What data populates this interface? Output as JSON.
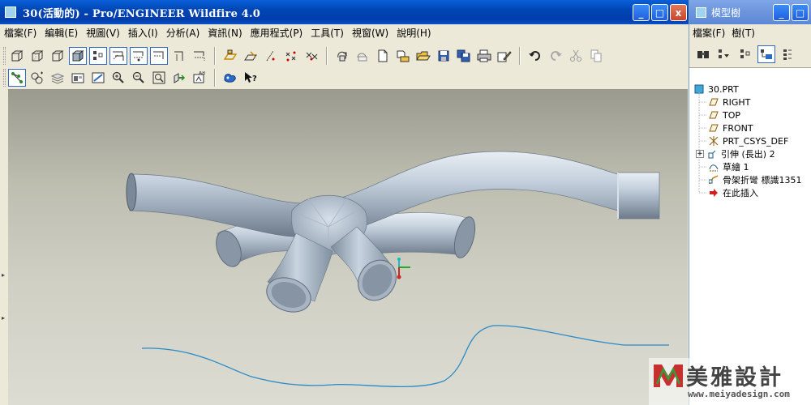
{
  "main_window": {
    "title": "30(活動的) - Pro/ENGINEER Wildfire 4.0",
    "menu": [
      "檔案(F)",
      "編輯(E)",
      "視圖(V)",
      "插入(I)",
      "分析(A)",
      "資訊(N)",
      "應用程式(P)",
      "工具(T)",
      "視窗(W)",
      "說明(H)"
    ],
    "window_controls": [
      "_",
      "□",
      "x"
    ]
  },
  "toolbar_icons_row1": [
    "view-wireframe-icon",
    "view-hidden-line-icon",
    "view-no-hidden-icon",
    "view-shading-icon",
    "datum-display-icon",
    "datum-axis-icon",
    "datum-point-icon",
    "datum-csys-icon",
    "datum-curve-icon",
    "datum-plane-tool-icon",
    "sketch-plane-icon",
    "datum-axis-tool-icon",
    "datum-point-tool-icon",
    "datum-csys-tool-icon",
    "regenerate-icon",
    "regen-manager-icon",
    "new-file-icon",
    "open-file-icon",
    "folder-browser-icon",
    "save-icon",
    "save-copy-icon",
    "print-icon",
    "sketch-tool-icon",
    "undo-icon",
    "redo-icon",
    "cut-icon",
    "copy-icon"
  ],
  "toolbar_icons_row2": [
    "select-node-icon",
    "named-views-icon",
    "layers-icon",
    "view-manager-icon",
    "repaint-icon",
    "zoom-in-icon",
    "zoom-out-icon",
    "refit-icon",
    "reorient-icon",
    "saved-views-icon",
    "model-tree-toggle-icon",
    "context-help-icon"
  ],
  "model_tree": {
    "title": "模型樹",
    "menu": [
      "檔案(F)",
      "樹(T)"
    ],
    "nodes": [
      {
        "label": "30.PRT",
        "icon": "part-icon"
      },
      {
        "label": "RIGHT",
        "icon": "datum-plane-icon"
      },
      {
        "label": "TOP",
        "icon": "datum-plane-icon"
      },
      {
        "label": "FRONT",
        "icon": "datum-plane-icon"
      },
      {
        "label": "PRT_CSYS_DEF",
        "icon": "csys-icon"
      },
      {
        "label": "引伸 (長出) 2",
        "icon": "extrude-icon",
        "expand": "+"
      },
      {
        "label": "草繪 1",
        "icon": "sketch-icon"
      },
      {
        "label": "骨架折彎 標識1351",
        "icon": "spinal-bend-icon"
      },
      {
        "label": "在此插入",
        "icon": "insert-here-icon"
      }
    ]
  },
  "watermark": {
    "text": "美雅設計",
    "url": "www.meiyadesign.com"
  },
  "colors": {
    "titlebar": "#0046b4",
    "viewport_top": "#9a9a8e",
    "viewport_bottom": "#dcdcd2",
    "pipe": "#b8c4d0",
    "curve": "#3a8ec8"
  }
}
